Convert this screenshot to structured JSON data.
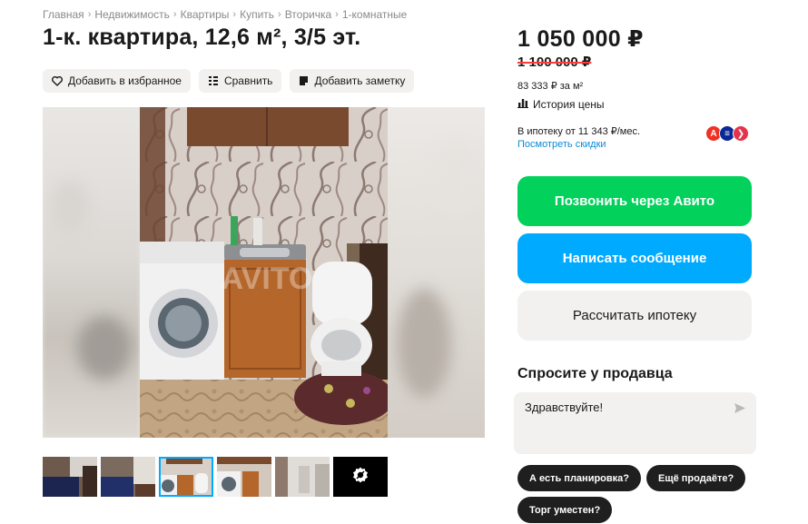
{
  "breadcrumbs": [
    "Главная",
    "Недвижимость",
    "Квартиры",
    "Купить",
    "Вторичка",
    "1-комнатные"
  ],
  "title": "1-к. квартира, 12,6 м², 3/5 эт.",
  "actions": {
    "favorite": "Добавить в избранное",
    "compare": "Сравнить",
    "note": "Добавить заметку"
  },
  "watermark": "AVITO",
  "price": {
    "current": "1 050 000 ₽",
    "old": "1 100 000 ₽",
    "per_m2": "83 333 ₽ за м²",
    "history": "История цены"
  },
  "mortgage": {
    "text": "В ипотеку от 11 343 ₽/мес.",
    "link": "Посмотреть скидки",
    "banks": [
      {
        "icon": "alfa-bank-icon",
        "symbol": "А",
        "color": "#ef3124"
      },
      {
        "icon": "vtb-bank-icon",
        "symbol": "≡",
        "color": "#0a2896"
      },
      {
        "icon": "sovcombank-icon",
        "symbol": "❯",
        "color": "#e4334a"
      }
    ]
  },
  "buttons": {
    "call": "Позвонить через Авито",
    "message": "Написать сообщение",
    "calc_mortgage": "Рассчитать ипотеку"
  },
  "ask": {
    "title": "Спросите у продавца",
    "input_value": "Здравствуйте!",
    "send_icon": "send-icon"
  },
  "quick_questions": [
    "А есть планировка?",
    "Ещё продаёте?",
    "Торг уместен?"
  ],
  "colors": {
    "green": "#02d15c",
    "blue": "#00aaff",
    "link": "#0a8bd8",
    "strike": "#ff3b3b"
  }
}
